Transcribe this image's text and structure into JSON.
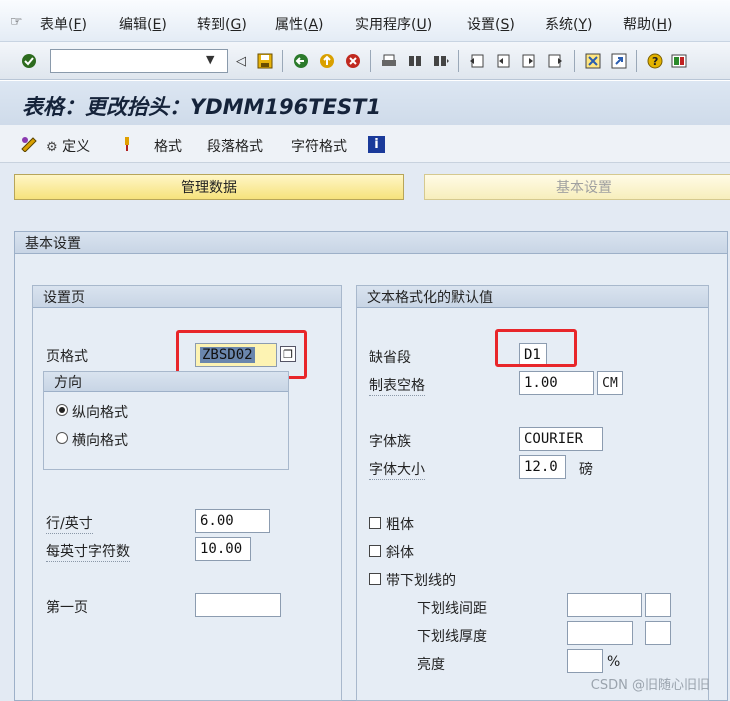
{
  "menu": [
    {
      "label": "表单(F)",
      "text": "表单(",
      "key": "F"
    },
    {
      "label": "编辑(E)",
      "text": "编辑(",
      "key": "E"
    },
    {
      "label": "转到(G)",
      "text": "转到(",
      "key": "G"
    },
    {
      "label": "属性(A)",
      "text": "属性(",
      "key": "A"
    },
    {
      "label": "实用程序(U)",
      "text": "实用程序(",
      "key": "U"
    },
    {
      "label": "设置(S)",
      "text": "设置(",
      "key": "S"
    },
    {
      "label": "系统(Y)",
      "text": "系统(",
      "key": "Y"
    },
    {
      "label": "帮助(H)",
      "text": "帮助(",
      "key": "H"
    }
  ],
  "toolbar": {
    "command_value": "",
    "icons": [
      "enter-check-icon",
      "back-arrow-icon",
      "save-icon",
      "back-icon",
      "exit-icon",
      "cancel-icon",
      "print-icon",
      "find-icon",
      "find-next-icon",
      "first-page-icon",
      "prev-page-icon",
      "next-page-icon",
      "last-page-icon",
      "new-session-icon",
      "shortcut-icon",
      "help-icon",
      "layout-icon"
    ]
  },
  "title": "表格：更改抬头：YDMM196TEST1",
  "app_toolbar": {
    "define_label": "定义",
    "format_label": "格式",
    "paragraph_format_label": "段落格式",
    "char_format_label": "字符格式"
  },
  "tabs": {
    "admin": "管理数据",
    "basic": "基本设置"
  },
  "basic_settings": {
    "header": "基本设置",
    "page_setup": {
      "header": "设置页",
      "page_format_label": "页格式",
      "page_format_value": "ZBSD02",
      "orientation_header": "方向",
      "portrait_label": "纵向格式",
      "landscape_label": "横向格式",
      "portrait_selected": true,
      "lines_per_inch_label": "行/英寸",
      "lines_per_inch_value": "6.00",
      "chars_per_inch_label": "每英寸字符数",
      "chars_per_inch_value": "10.00",
      "first_page_label": "第一页",
      "first_page_value": ""
    },
    "text_format": {
      "header": "文本格式化的默认值",
      "default_para_label": "缺省段",
      "default_para_value": "D1",
      "tab_spacing_label": "制表空格",
      "tab_spacing_value": "1.00",
      "tab_spacing_unit": "CM",
      "font_family_label": "字体族",
      "font_family_value": "COURIER",
      "font_size_label": "字体大小",
      "font_size_value": "12.0",
      "font_size_unit": "磅",
      "bold_label": "粗体",
      "italic_label": "斜体",
      "underline_label": "带下划线的",
      "ul_spacing_label": "下划线间距",
      "ul_thickness_label": "下划线厚度",
      "brightness_label": "亮度",
      "brightness_unit": "%"
    }
  },
  "watermark": "CSDN @旧随心旧旧"
}
